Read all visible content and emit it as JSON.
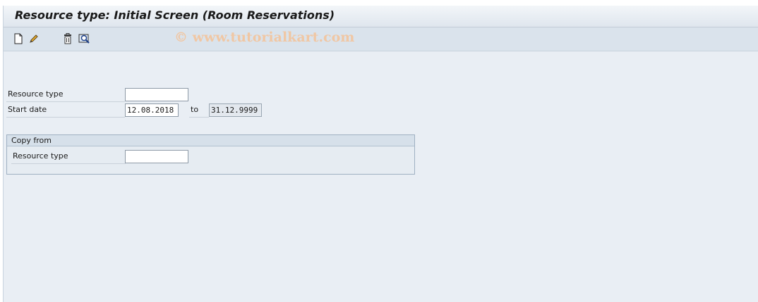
{
  "window": {
    "title": "Resource type: Initial Screen (Room Reservations)"
  },
  "toolbar": {
    "buttons": [
      {
        "icon": "new-document-icon"
      },
      {
        "icon": "pencil-edit-icon"
      },
      {
        "icon": "trash-delete-icon"
      },
      {
        "icon": "magnifier-display-icon"
      }
    ],
    "watermark": "© www.tutorialkart.com"
  },
  "form": {
    "resource_type": {
      "label": "Resource type",
      "value": ""
    },
    "start_date": {
      "label": "Start date",
      "value": "12.08.2018",
      "to_label": "to",
      "to_value": "31.12.9999"
    }
  },
  "copy_from": {
    "title": "Copy from",
    "resource_type": {
      "label": "Resource type",
      "value": ""
    }
  },
  "colors": {
    "background": "#e9eef4",
    "toolbar": "#dae3ec",
    "watermark": "#f0c7a4"
  }
}
